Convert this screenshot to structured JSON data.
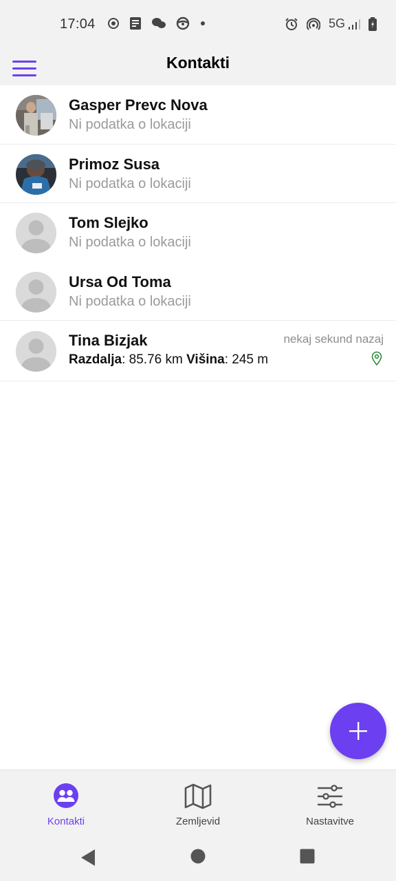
{
  "status_bar": {
    "time": "17:04",
    "network": "5G",
    "left_icons": [
      "record-icon",
      "note-icon",
      "chat-icon",
      "steering-icon",
      "dot-icon"
    ],
    "right_icons": [
      "alarm-icon",
      "hotspot-icon",
      "signal-icon",
      "battery-icon"
    ]
  },
  "app_bar": {
    "title": "Kontakti",
    "menu_icon": "hamburger-menu-icon"
  },
  "contacts": [
    {
      "name": "Gasper Prevc Nova",
      "subtitle": "Ni podatka o lokaciji",
      "avatar": "photo"
    },
    {
      "name": "Primoz Susa",
      "subtitle": "Ni podatka o lokaciji",
      "avatar": "photo"
    },
    {
      "name": "Tom Slejko",
      "subtitle": "Ni podatka o lokaciji",
      "avatar": "default"
    },
    {
      "name": "Ursa Od Toma",
      "subtitle": "Ni podatka o lokaciji",
      "avatar": "default"
    },
    {
      "name": "Tina Bizjak",
      "avatar": "default",
      "time": "nekaj sekund nazaj",
      "distance_label": "Razdalja",
      "distance_value": ": 85.76 km",
      "altitude_label": "Višina",
      "altitude_value": ": 245 m",
      "location_icon": "map-pin-icon"
    }
  ],
  "fab": {
    "icon": "plus-icon"
  },
  "bottom_nav": [
    {
      "label": "Kontakti",
      "icon": "contacts-icon",
      "active": true
    },
    {
      "label": "Zemljevid",
      "icon": "map-icon",
      "active": false
    },
    {
      "label": "Nastavitve",
      "icon": "settings-sliders-icon",
      "active": false
    }
  ],
  "system_nav": [
    "back-icon",
    "home-icon",
    "recents-icon"
  ],
  "colors": {
    "accent": "#6c3ff0",
    "muted_text": "#9a9a9a",
    "bar_background": "#f2f2f2",
    "pin_green": "#2e8b3d"
  }
}
